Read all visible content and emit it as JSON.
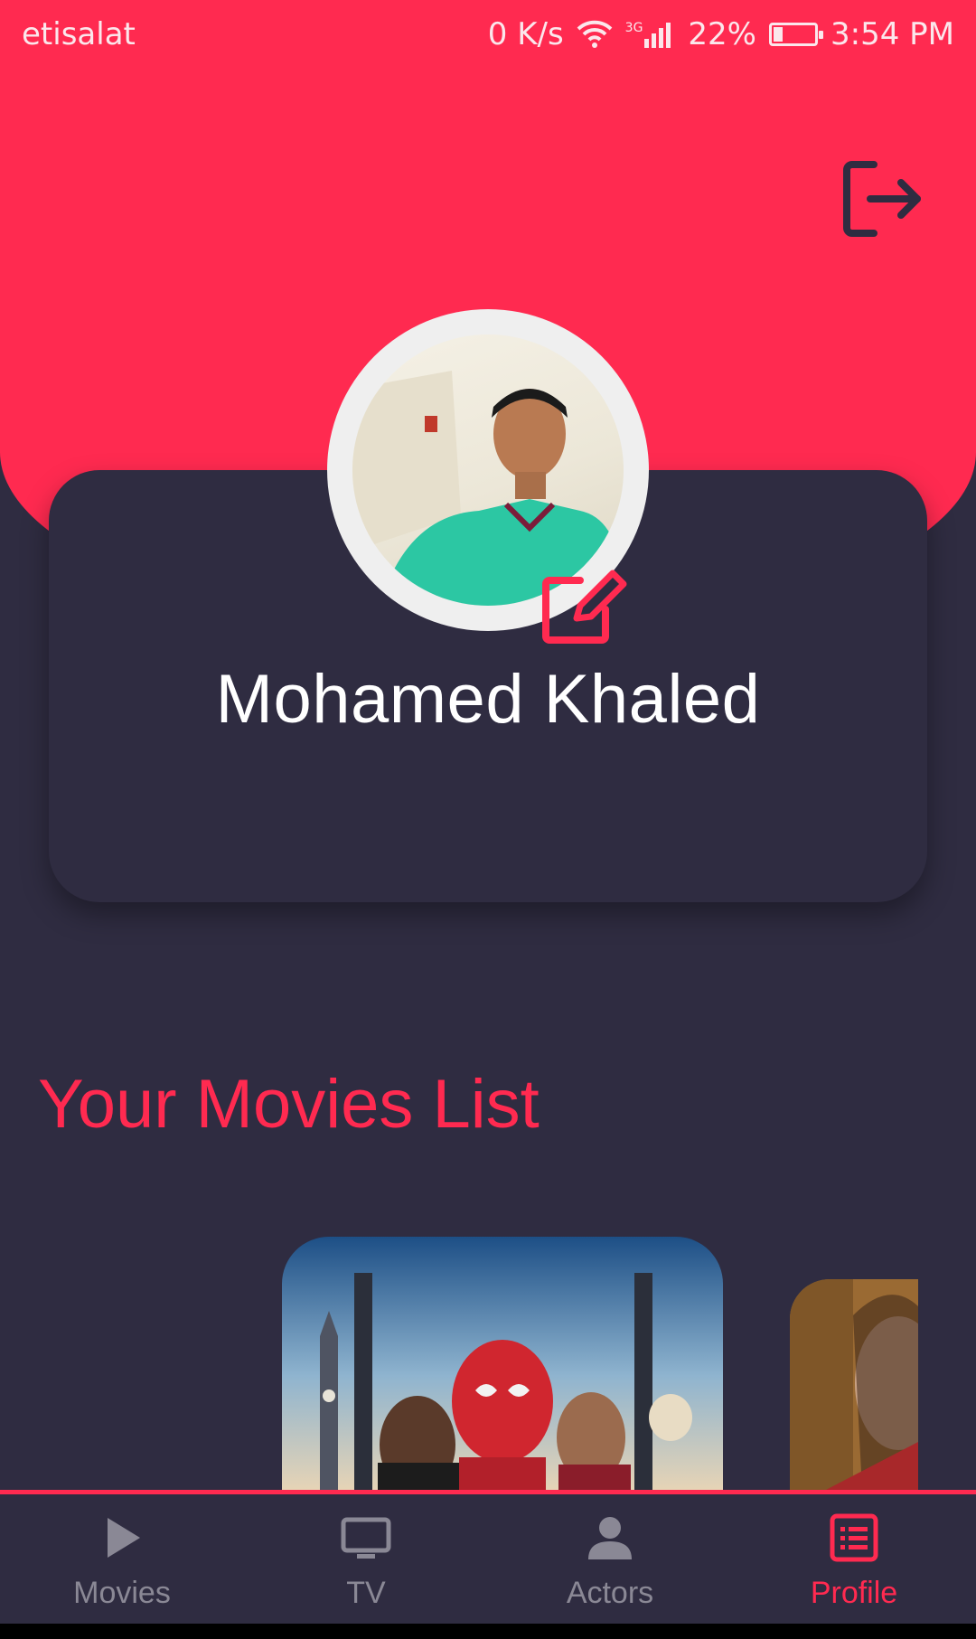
{
  "status_bar": {
    "carrier": "etisalat",
    "speed": "0 K/s",
    "network": "3G",
    "battery": "22%",
    "time": "3:54 PM"
  },
  "profile": {
    "name": "Mohamed Khaled",
    "logout_icon": "logout-icon",
    "edit_icon": "edit-icon"
  },
  "movies_section": {
    "title": "Your Movies List"
  },
  "bottom_nav": {
    "items": [
      {
        "label": "Movies",
        "icon": "play-icon",
        "active": false
      },
      {
        "label": "TV",
        "icon": "tv-icon",
        "active": false
      },
      {
        "label": "Actors",
        "icon": "person-icon",
        "active": false
      },
      {
        "label": "Profile",
        "icon": "list-icon",
        "active": true
      }
    ]
  },
  "colors": {
    "accent": "#ff2a50",
    "background": "#2f2c41",
    "inactive": "#8a8895",
    "text": "#ffffff"
  }
}
